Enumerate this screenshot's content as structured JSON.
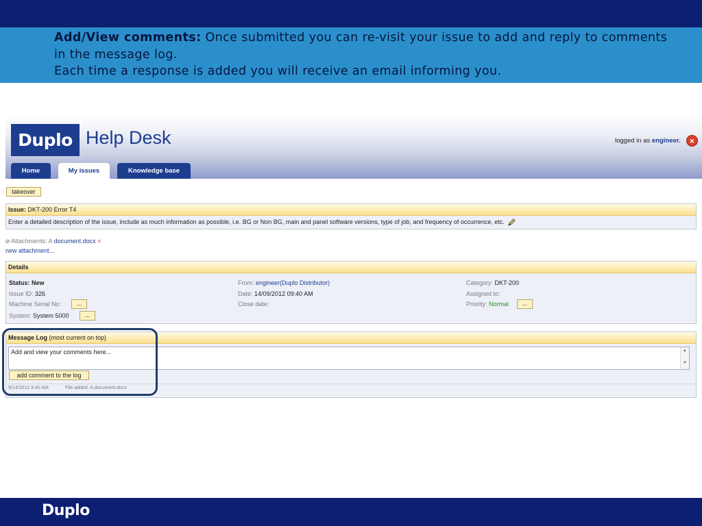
{
  "slide": {
    "caption_title": "Add/View comments:",
    "caption_line1": " Once submitted you can re-visit your issue to add and reply to comments in the message log.",
    "caption_line2": "Each time a response is added you will receive an email informing you.",
    "footer_logo": "Duplo"
  },
  "app": {
    "logo": "Duplo",
    "title": "Help Desk",
    "login_prefix": "logged in as ",
    "login_user": "engineer.",
    "tabs": [
      {
        "label": "Home",
        "active": false
      },
      {
        "label": "My issues",
        "active": true
      },
      {
        "label": "Knowledge base",
        "active": false
      }
    ]
  },
  "issue": {
    "takeover_label": "takeover",
    "header_label": "Issue:",
    "header_value": " DKT-200 Error T4",
    "description": "Enter a detailed description of the issue, include as much information as possible, i.e. BG or Non BG, main and panel software versions, type of job, and frequency of occurrence, etc.",
    "attachments_label": "Attachments: A ",
    "attachment_file": "document.docx",
    "remove_mark": "×",
    "new_attachment": "new attachment..."
  },
  "details": {
    "title": "Details",
    "status": "Status: New",
    "issue_id_label": "Issue ID:",
    "issue_id": "326",
    "serial_label": "Machine Serial No:",
    "system_label": "System:",
    "system_value": "System 5000",
    "from_label": "From:",
    "from_value": "engineer(Duplo Distributor)",
    "date_label": "Date:",
    "date_value": "14/09/2012 09:40 AM",
    "close_label": "Close date:",
    "category_label": "Category:",
    "category_value": "DKT-200",
    "assigned_label": "Assigned to:",
    "priority_label": "Priority:",
    "priority_value": "Normal",
    "ellipsis": "..."
  },
  "message_log": {
    "title": "Message Log",
    "subtitle": " (most current on top)",
    "placeholder": "Add and view your comments here...",
    "add_button": "add comment to the log",
    "entry_time": "9/14/2012 9:40 AM",
    "entry_text": "File added: A document.docx"
  }
}
